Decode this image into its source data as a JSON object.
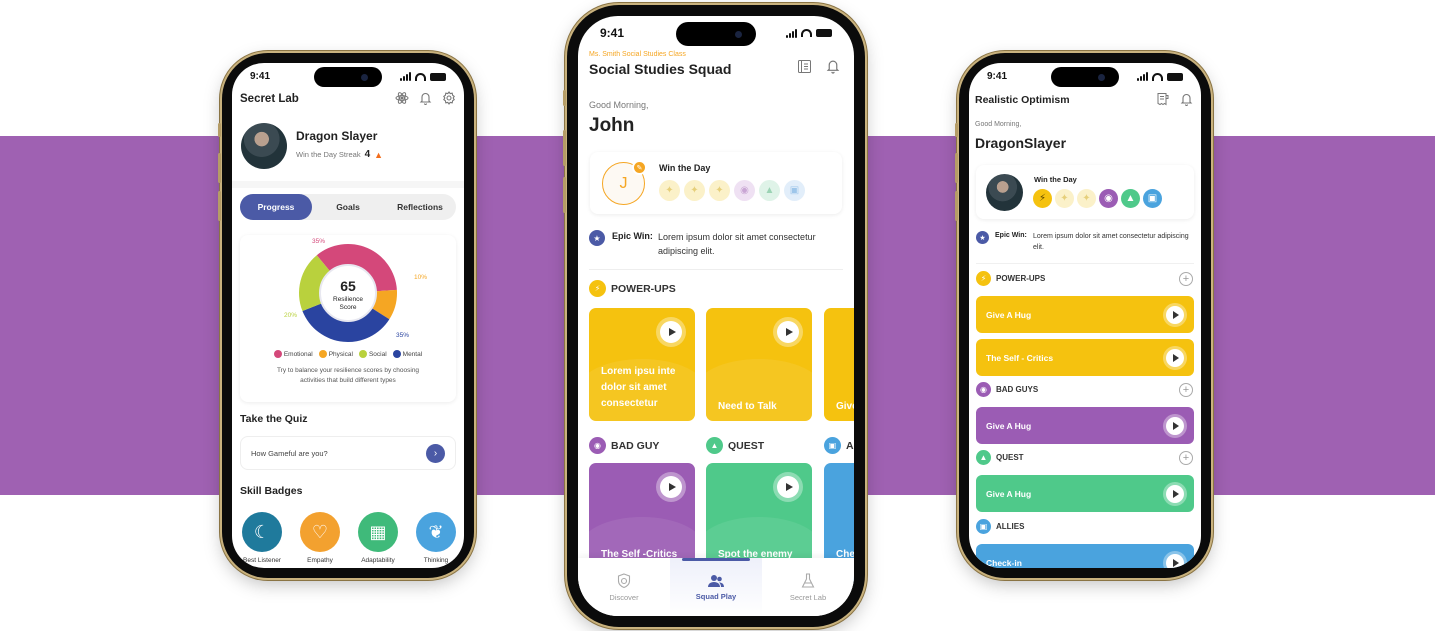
{
  "colors": {
    "band": "#9f61b2",
    "primary": "#4b5aa6",
    "accent_orange": "#f5a623",
    "emotional": "#d4487a",
    "physical": "#f5a623",
    "social": "#b9d13d",
    "mental": "#2a44a0",
    "powerups": "#f5c20f",
    "badguy": "#9b5cb4",
    "quest": "#4fc98a",
    "allies": "#4aa3de"
  },
  "status_bar": {
    "time": "9:41"
  },
  "phone1": {
    "header": {
      "title": "Secret Lab",
      "icons": [
        "atom-icon",
        "bell-icon",
        "settings-icon"
      ]
    },
    "profile": {
      "name": "Dragon Slayer",
      "streak_label": "Win the Day Streak",
      "streak_value": "4",
      "streak_icon": "fire-icon"
    },
    "tabs": [
      {
        "label": "Progress",
        "active": true
      },
      {
        "label": "Goals",
        "active": false
      },
      {
        "label": "Reflections",
        "active": false
      }
    ],
    "resilience": {
      "score": "65",
      "score_label_1": "Resilience",
      "score_label_2": "Score",
      "segments": [
        {
          "name": "Emotional",
          "percent": 35,
          "label": "35%"
        },
        {
          "name": "Physical",
          "percent": 10,
          "label": "10%"
        },
        {
          "name": "Mental",
          "percent": 35,
          "label": "35%"
        },
        {
          "name": "Social",
          "percent": 20,
          "label": "20%"
        }
      ],
      "legend": [
        "Emotional",
        "Physical",
        "Social",
        "Mental"
      ],
      "hint": "Try to balance your resilience scores by choosing activities that build different types"
    },
    "quiz": {
      "heading": "Take the Quiz",
      "question": "How Gameful are you?"
    },
    "badges": {
      "heading": "Skill Badges",
      "items": [
        {
          "label": "Best Listener",
          "icon": "ear-icon",
          "color": "#1f7a9c"
        },
        {
          "label": "Empathy",
          "icon": "heart-hand-icon",
          "color": "#f3a12f"
        },
        {
          "label": "Adaptability",
          "icon": "puzzle-icon",
          "color": "#3fba7a"
        },
        {
          "label": "Thinking",
          "icon": "brain-hands-icon",
          "color": "#4aa3de"
        }
      ]
    }
  },
  "phone2": {
    "header": {
      "subtitle": "Ms. Smith Social Studies Class",
      "title": "Social Studies Squad"
    },
    "greeting": "Good Morning,",
    "name": "John",
    "avatar_initial": "J",
    "win_the_day": {
      "label": "Win the Day"
    },
    "epic_win": {
      "label": "Epic Win:",
      "text": "Lorem ipsum dolor sit amet consectetur adipiscing elit."
    },
    "powerups": {
      "heading": "POWER-UPS",
      "cards": [
        "Lorem ipsu inte dolor sit amet consectetur",
        "Need to Talk",
        "Give"
      ]
    },
    "sections2": [
      {
        "heading": "BAD GUY",
        "card": "The Self -Critics"
      },
      {
        "heading": "QUEST",
        "card": "Spot the enemy"
      },
      {
        "heading": "AL",
        "card": "Che"
      }
    ],
    "nav": [
      {
        "label": "Discover",
        "icon": "compass-shield-icon",
        "active": false
      },
      {
        "label": "Squad Play",
        "icon": "users-icon",
        "active": true
      },
      {
        "label": "Secret Lab",
        "icon": "flask-icon",
        "active": false
      }
    ]
  },
  "phone3": {
    "header": {
      "title": "Realistic Optimism"
    },
    "greeting": "Good Morning,",
    "name": "DragonSlayer",
    "win_the_day": {
      "label": "Win the Day"
    },
    "epic_win": {
      "label": "Epic Win:",
      "text": "Lorem ipsum dolor sit amet consectetur adipiscing elit."
    },
    "sections": [
      {
        "heading": "POWER-UPS",
        "items": [
          "Give A Hug",
          "The Self - Critics"
        ]
      },
      {
        "heading": "BAD GUYS",
        "items": [
          "Give A Hug"
        ]
      },
      {
        "heading": "QUEST",
        "items": [
          "Give A Hug"
        ]
      },
      {
        "heading": "ALLIES",
        "items": [
          "Check-in"
        ]
      }
    ]
  }
}
